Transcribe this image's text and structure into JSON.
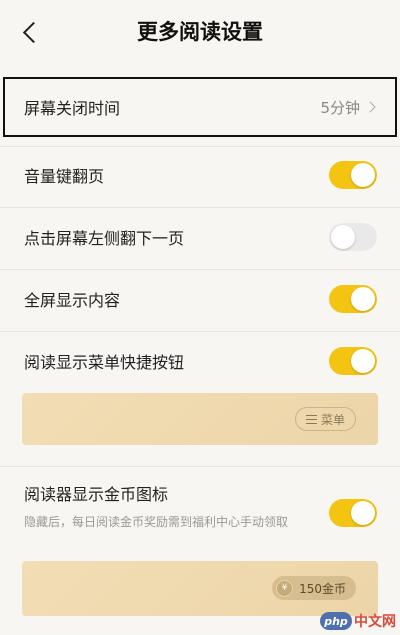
{
  "header": {
    "title": "更多阅读设置"
  },
  "screen_off": {
    "label": "屏幕关闭时间",
    "value": "5分钟"
  },
  "settings": [
    {
      "label": "音量键翻页",
      "on": true
    },
    {
      "label": "点击屏幕左侧翻下一页",
      "on": false
    },
    {
      "label": "全屏显示内容",
      "on": true
    },
    {
      "label": "阅读显示菜单快捷按钮",
      "on": true
    },
    {
      "label": "阅读器显示金币图标",
      "on": true
    }
  ],
  "menu_preview": {
    "chip_label": "菜单"
  },
  "coin_setting": {
    "description": "隐藏后，每日阅读金币奖励需到福利中心手动领取"
  },
  "coin_preview": {
    "chip_label": "150金币",
    "coin_symbol": "¥"
  },
  "watermark": {
    "logo_text": "php",
    "site_text": "中文网"
  },
  "colors": {
    "toggle_on": "#f3c412",
    "toggle_off": "#e9e9e9",
    "background": "#f7f6f2"
  }
}
